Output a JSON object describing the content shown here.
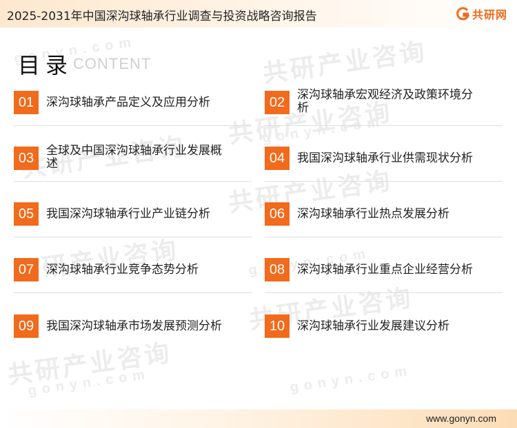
{
  "header": {
    "title": "2025-2031年中国深沟球轴承行业调查与投资战略咨询报告",
    "logo_text": "共研网",
    "accent_color": "#f26a1b"
  },
  "toc": {
    "title": "目录",
    "subtitle": "CONTENT",
    "items": [
      {
        "num": "01",
        "label": "深沟球轴承产品定义及应用分析"
      },
      {
        "num": "02",
        "label": "深沟球轴承宏观经济及政策环境分析"
      },
      {
        "num": "03",
        "label": "全球及中国深沟球轴承行业发展概述"
      },
      {
        "num": "04",
        "label": "我国深沟球轴承行业供需现状分析"
      },
      {
        "num": "05",
        "label": "我国深沟球轴承行业产业链分析"
      },
      {
        "num": "06",
        "label": "深沟球轴承行业热点发展分析"
      },
      {
        "num": "07",
        "label": "深沟球轴承行业竞争态势分析"
      },
      {
        "num": "08",
        "label": "深沟球轴承行业重点企业经营分析"
      },
      {
        "num": "09",
        "label": "我国深沟球轴承市场发展预测分析"
      },
      {
        "num": "10",
        "label": "深沟球轴承行业发展建议分析"
      }
    ]
  },
  "watermark": {
    "brand": "共研产业咨询",
    "url": "gonyn.com"
  },
  "footer": {
    "url": "www.gonyn.com"
  }
}
